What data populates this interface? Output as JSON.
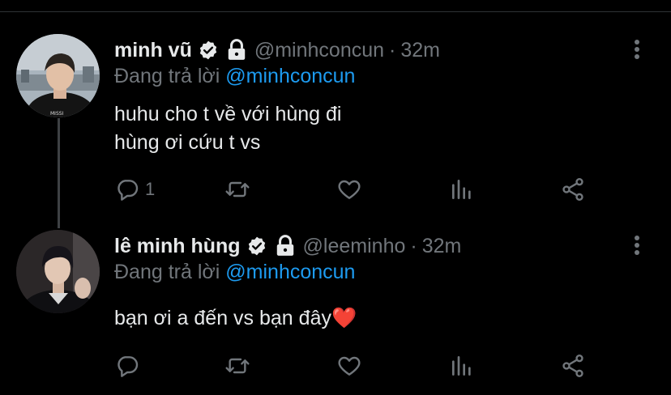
{
  "thread": [
    {
      "name": "minh vũ",
      "handle": "@minhconcun",
      "time": "32m",
      "separator": "·",
      "replying_prefix": "Đang trả lời ",
      "replying_to": "@minhconcun",
      "text_lines": [
        "huhu cho t về với hùng đi",
        "hùng ơi cứu t vs"
      ],
      "reply_count": "1",
      "verified": true,
      "protected": true
    },
    {
      "name": "lê minh hùng",
      "handle": "@leeminho",
      "time": "32m",
      "separator": "·",
      "replying_prefix": "Đang trả lời ",
      "replying_to": "@minhconcun",
      "text_lines": [
        "bạn ơi a đến vs bạn đây❤️"
      ],
      "reply_count": "",
      "verified": true,
      "protected": true
    }
  ],
  "icons": {
    "reply": "speech-bubble-icon",
    "retweet": "retweet-icon",
    "like": "heart-icon",
    "views": "bar-chart-icon",
    "share": "share-icon",
    "more": "more-dots-icon",
    "verified": "verified-badge-icon",
    "protected": "lock-icon"
  },
  "colors": {
    "background": "#000000",
    "text": "#e7e9ea",
    "muted": "#71767b",
    "mention": "#1d9bf0",
    "thread_line": "#3e4144"
  }
}
